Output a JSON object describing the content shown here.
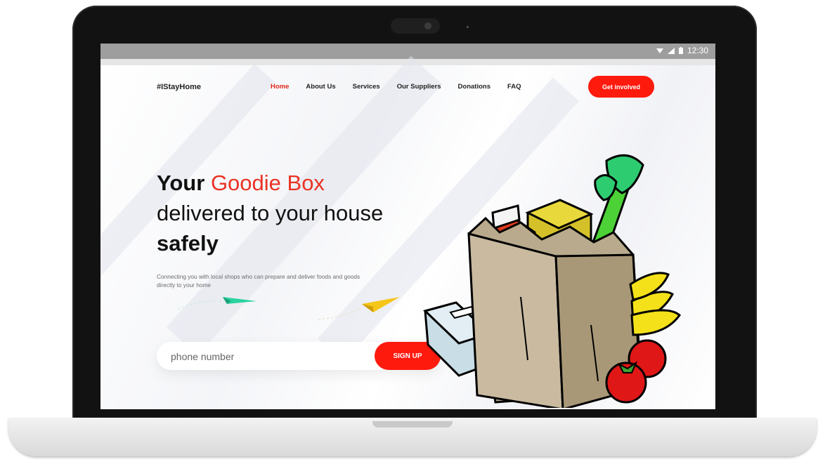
{
  "status_bar": {
    "time": "12:30",
    "icons": [
      "wifi-icon",
      "signal-icon",
      "battery-icon"
    ]
  },
  "site": {
    "logo": "#IStayHome",
    "nav": [
      {
        "label": "Home",
        "active": true
      },
      {
        "label": "About Us",
        "active": false
      },
      {
        "label": "Services",
        "active": false
      },
      {
        "label": "Our Suppliers",
        "active": false
      },
      {
        "label": "Donations",
        "active": false
      },
      {
        "label": "FAQ",
        "active": false
      }
    ],
    "cta": "Get involved"
  },
  "hero": {
    "title_part1": "Your",
    "title_highlight": "Goodie Box",
    "title_line2": "delivered to your house",
    "title_line3": "safely",
    "subtitle": "Connecting you with local shops who can prepare and deliver foods and goods directly to your home"
  },
  "signup": {
    "placeholder": "phone number",
    "button": "SIGN UP"
  },
  "colors": {
    "accent": "#ff1a0e",
    "highlight": "#ea3323",
    "plane_green": "#2ad3a0",
    "plane_yellow": "#f5c518"
  }
}
